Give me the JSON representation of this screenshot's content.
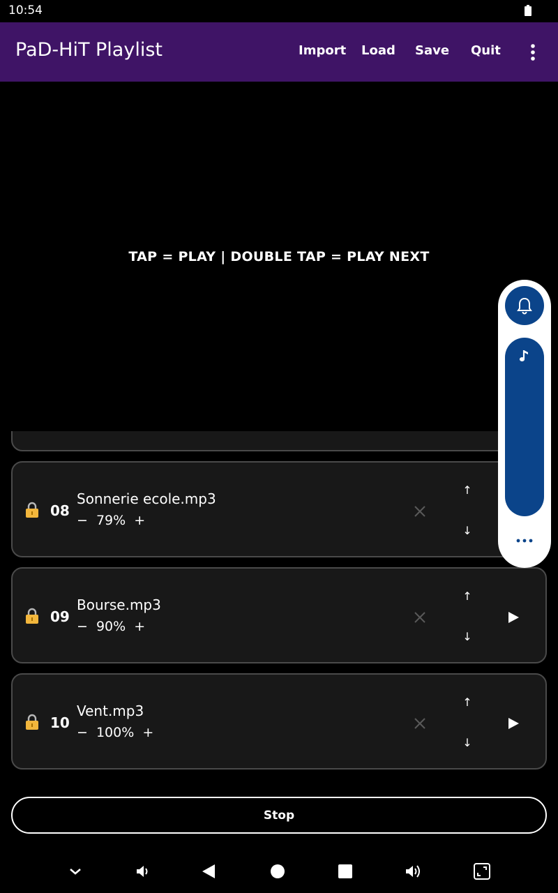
{
  "status_bar": {
    "time": "10:54"
  },
  "app_bar": {
    "title": "PaD-HiT Playlist",
    "menu": [
      "Import",
      "Load",
      "Save",
      "Quit"
    ]
  },
  "player": {
    "hint": "TAP = PLAY | DOUBLE TAP = PLAY NEXT"
  },
  "tracks": [
    {
      "number": "08",
      "name": "Sonnerie ecole.mp3",
      "minus": "−",
      "volume": "79%",
      "plus": "+",
      "up": "↑",
      "down": "↓"
    },
    {
      "number": "09",
      "name": "Bourse.mp3",
      "minus": "−",
      "volume": "90%",
      "plus": "+",
      "up": "↑",
      "down": "↓"
    },
    {
      "number": "10",
      "name": "Vent.mp3",
      "minus": "−",
      "volume": "100%",
      "plus": "+",
      "up": "↑",
      "down": "↓"
    }
  ],
  "stop_button": {
    "label": "Stop"
  },
  "volume_panel": {
    "accent": "#0b448a"
  },
  "colors": {
    "app_bar": "#3f1466",
    "card_bg": "#181818",
    "card_border": "#4a4a4a",
    "lock": "#f2b63c"
  }
}
